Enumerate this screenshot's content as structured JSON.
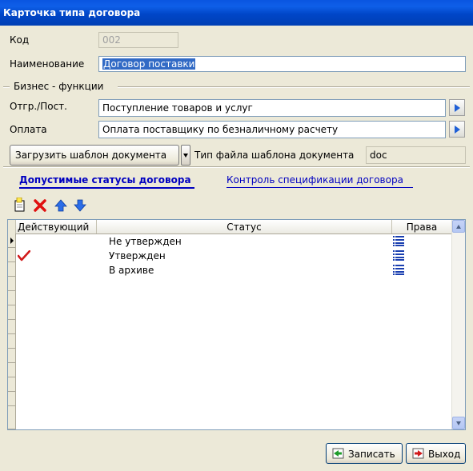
{
  "window": {
    "title": "Карточка типа договора"
  },
  "form": {
    "code_label": "Код",
    "code_value": "002",
    "name_label": "Наименование",
    "name_value": "Договор поставки",
    "business_group_label": "Бизнес - функции",
    "shipment_label": "Отгр./Пост.",
    "shipment_value": "Поступление товаров и услуг",
    "payment_label": "Оплата",
    "payment_value": "Оплата поставщику по безналичному расчету",
    "load_template_label": "Загрузить шаблон документа",
    "template_type_label": "Тип файла шаблона документа",
    "template_type_value": "doc"
  },
  "tabs": [
    {
      "label": "Допустимые статусы договора",
      "active": true
    },
    {
      "label": "Контроль спецификации договора",
      "active": false
    }
  ],
  "toolbar": {
    "icons": [
      "new-record-icon",
      "delete-icon",
      "move-up-icon",
      "move-down-icon"
    ]
  },
  "grid": {
    "columns": [
      "Действующий",
      "Статус",
      "Права"
    ],
    "rows": [
      {
        "active": false,
        "status": "Не утвержден",
        "current": true
      },
      {
        "active": true,
        "status": "Утвержден",
        "current": false
      },
      {
        "active": false,
        "status": "В архиве",
        "current": false
      }
    ]
  },
  "buttons": {
    "save": "Записать",
    "exit": "Выход"
  },
  "colors": {
    "title_bar": "#0054e3",
    "link": "#0000c0",
    "selection": "#316ac5",
    "check": "#d11a1a"
  }
}
